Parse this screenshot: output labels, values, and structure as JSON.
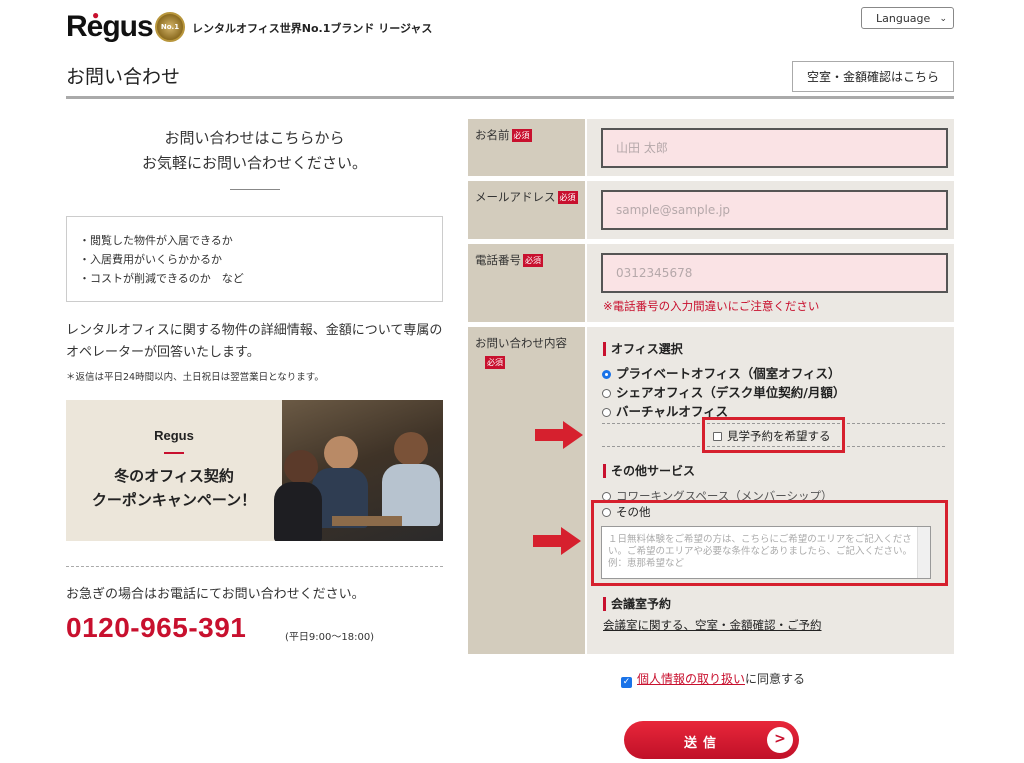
{
  "header": {
    "logo": "Regus",
    "medal": "No.1",
    "tagline": "レンタルオフィス世界No.1ブランド リージャス",
    "language": "Language",
    "page_title": "お問い合わせ",
    "vacancy_button": "空室・金額確認はこちら"
  },
  "left": {
    "intro_line1": "お問い合わせはこちらから",
    "intro_line2": "お気軽にお問い合わせください。",
    "checks": [
      "・閲覧した物件が入居できるか",
      "・入居費用がいくらかかるか",
      "・コストが削減できるのか　など"
    ],
    "description": "レンタルオフィスに関する物件の詳細情報、金額について専属のオペレーターが回答いたします。",
    "note": "＊返信は平日24時間以内、土日祝日は翌営業日となります。",
    "banner_logo": "Regus",
    "banner_line1": "冬のオフィス契約",
    "banner_line2": "クーポンキャンペーン！",
    "urgent": "お急ぎの場合はお電話にてお問い合わせください。",
    "phone": "0120-965-391",
    "phone_hours": "(平日9:00～18:00)"
  },
  "form": {
    "required_badge": "必須",
    "name_label": "お名前",
    "name_placeholder": "山田 太郎",
    "email_label": "メールアドレス",
    "email_placeholder": "sample@sample.jp",
    "tel_label": "電話番号",
    "tel_placeholder": "0312345678",
    "tel_hint": "※電話番号の入力間違いにご注意ください",
    "inquiry_label": "お問い合わせ内容",
    "office_section": "オフィス選択",
    "office_options": [
      "プライベートオフィス（個室オフィス）",
      "シェアオフィス（デスク単位契約/月額）",
      "バーチャルオフィス"
    ],
    "office_selected": "プライベートオフィス（個室オフィス）",
    "tour_checkbox": "見学予約を希望する",
    "other_section": "その他サービス",
    "other_options": [
      "コワーキングスペース（メンバーシップ）",
      "その他"
    ],
    "textarea_placeholder": "１日無料体験をご希望の方は、こちらにご希望のエリアをご記入ください。ご希望のエリアや必要な条件などありましたら、ご記入ください。例：恵那希望など",
    "meeting_section": "会議室予約",
    "meeting_link": "会議室に関する、空室・金額確認・ご予約",
    "consent_link": "個人情報の取り扱い",
    "consent_suffix": "に同意する",
    "consent_checked": true,
    "submit": "送信"
  },
  "colors": {
    "brand_red": "#c8102e",
    "annotation_red": "#d6202e",
    "label_bg": "#d3ccbd",
    "field_bg": "#ebe8e3",
    "input_bg": "#fae3e5"
  }
}
